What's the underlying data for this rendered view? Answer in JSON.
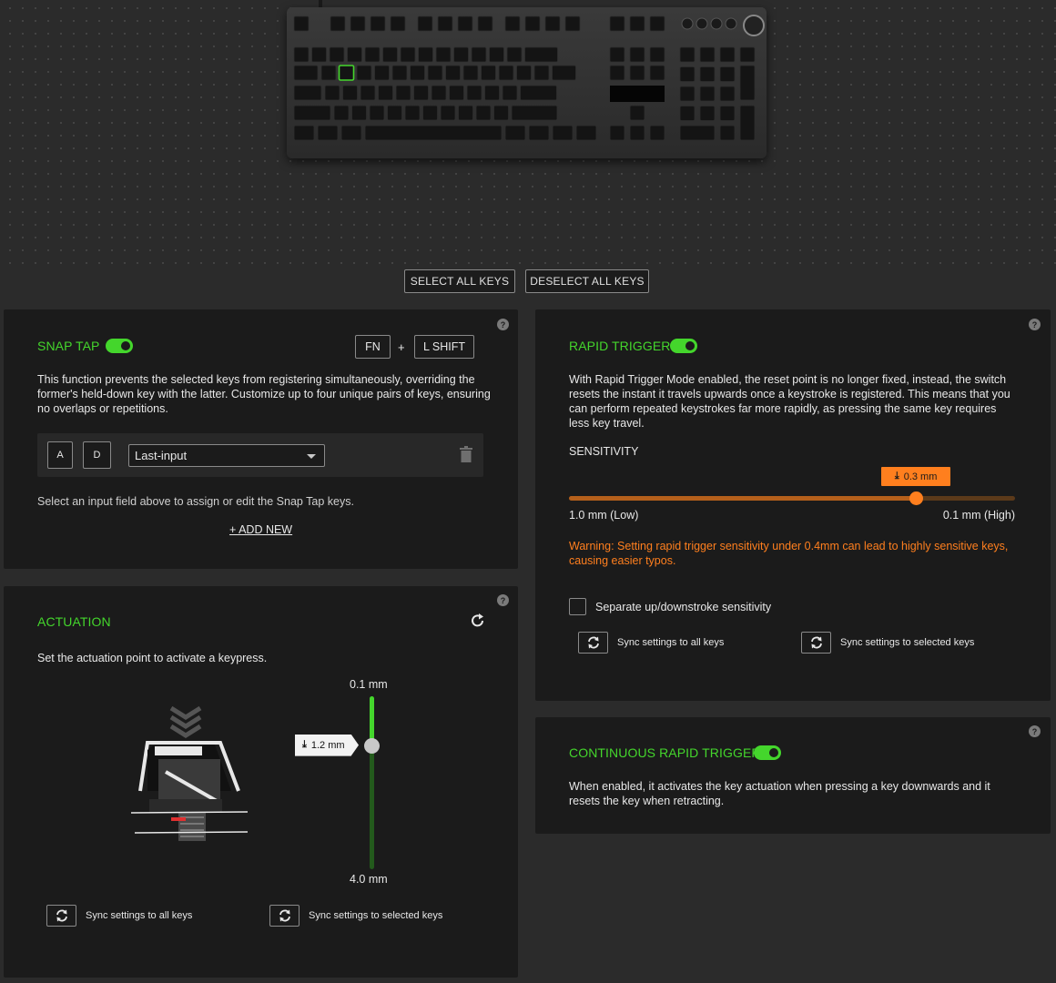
{
  "keyboard": {
    "image_name": "keyboard-image"
  },
  "top_buttons": {
    "select_all": "SELECT ALL KEYS",
    "deselect_all": "DESELECT ALL KEYS"
  },
  "snap_tap": {
    "title": "SNAP TAP",
    "enabled": true,
    "shortcut_key1": "FN",
    "shortcut_plus": "+",
    "shortcut_key2": "L SHIFT",
    "description": "This function prevents the selected keys from registering simultaneously, overriding the former's held-down key with the latter. Customize up to four unique pairs of keys, ensuring no overlaps or repetitions.",
    "pair_key1": "A",
    "pair_key2": "D",
    "mode_value": "Last-input",
    "hint": "Select an input field above to assign or edit the Snap Tap keys.",
    "add_new": "+ ADD NEW"
  },
  "actuation": {
    "title": "ACTUATION",
    "description": "Set the actuation point to activate a keypress.",
    "top_label": "0.1 mm",
    "bottom_label": "4.0 mm",
    "value_label": "1.2 mm",
    "value": 1.2,
    "sync_all": "Sync settings to all keys",
    "sync_selected": "Sync settings to selected keys"
  },
  "rapid_trigger": {
    "title": "RAPID TRIGGER",
    "enabled": true,
    "description": "With Rapid Trigger Mode enabled, the reset point is no longer fixed, instead, the switch resets the instant it travels upwards once a keystroke is registered. This means that you can perform repeated keystrokes far more rapidly, as pressing the same key requires less key travel.",
    "sensitivity_label": "SENSITIVITY",
    "value_label": "0.3 mm",
    "value": 0.3,
    "left_label": "1.0 mm (Low)",
    "right_label": "0.1 mm (High)",
    "warning": "Warning: Setting rapid trigger sensitivity under 0.4mm can lead to highly sensitive keys, causing easier typos.",
    "checkbox_label": "Separate up/downstroke sensitivity",
    "checkbox_checked": false,
    "sync_all": "Sync settings to all keys",
    "sync_selected": "Sync settings to selected keys"
  },
  "continuous_rapid_trigger": {
    "title": "CONTINUOUS RAPID TRIGGER",
    "enabled": true,
    "description": "When enabled, it activates the key actuation when pressing a key downwards and it resets the key when retracting."
  },
  "colors": {
    "accent_green": "#44d62c",
    "warning_orange": "#ff7f1e",
    "panel_bg": "#1b1b1b"
  },
  "help_mark": "?"
}
